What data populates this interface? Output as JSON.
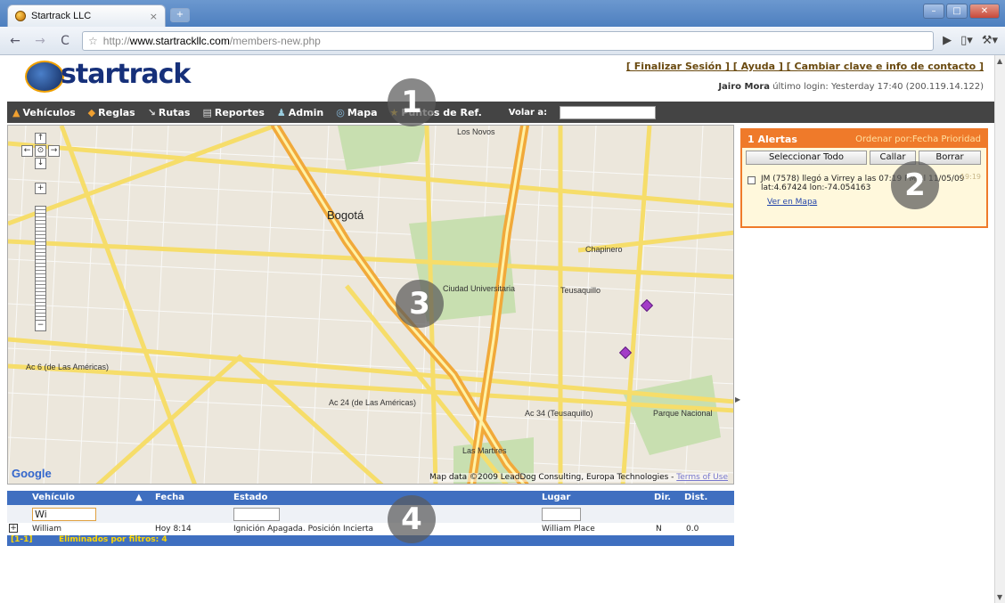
{
  "browser": {
    "tab_title": "Startrack LLC",
    "tab_close": "×",
    "url_proto": "http://",
    "url_host": "www.startrackllc.com",
    "url_path": "/members-new.php"
  },
  "header": {
    "logo_text": "startrack",
    "links": "[ Finalizar Sesión ] [ Ayuda ] [ Cambiar clave e info de contacto ]",
    "user_name": "Jairo Mora",
    "login_text": "último login: Yesterday 17:40 (200.119.14.122)"
  },
  "menu": {
    "items": [
      {
        "label": "Vehículos",
        "icon": "truck-icon"
      },
      {
        "label": "Reglas",
        "icon": "rules-icon"
      },
      {
        "label": "Rutas",
        "icon": "route-icon"
      },
      {
        "label": "Reportes",
        "icon": "report-icon"
      },
      {
        "label": "Admin",
        "icon": "admin-icon"
      },
      {
        "label": "Mapa",
        "icon": "globe-icon"
      },
      {
        "label": "Puntos de Ref.",
        "icon": "star-icon"
      }
    ],
    "volar_label": "Volar a:"
  },
  "map": {
    "city_label": "Bogotá",
    "labels": [
      "Ciudad Universitaria",
      "Teusaquillo",
      "Chapinero",
      "Parque Nacional",
      "Las Martires",
      "Los Novos",
      "Ac 6 (de Las Américas)",
      "Ac 24 (de Las Américas)",
      "Ac 34 (Teusaquillo)"
    ],
    "google": "Google",
    "attribution": "Map data ©2009 LeadDog Consulting, Europa Technologies -",
    "terms": "Terms of Use"
  },
  "alerts": {
    "title": "1 Alertas",
    "sort_label": "Ordenar por:Fecha Prioridad",
    "select_all": "Seleccionar Todo",
    "mute": "Callar",
    "delete": "Borrar",
    "item_text": "JM (7578) llegó a Virrey a las 07:19 PM el 11/05/09 lat:4.67424 lon:-74.054163",
    "item_time": "19:19",
    "map_link": "Ver en Mapa"
  },
  "grid": {
    "headers": {
      "vehiculo": "Vehículo",
      "fecha": "Fecha",
      "estado": "Estado",
      "lugar": "Lugar",
      "dir": "Dir.",
      "dist": "Dist."
    },
    "filter_value": "Wi",
    "row": {
      "vehiculo": "William",
      "fecha": "Hoy 8:14",
      "estado": "Ignición Apagada. Posición Incierta",
      "lugar": "William Place",
      "dir": "N",
      "dist": "0.0"
    },
    "footer_count": "[1-1]",
    "footer_text": "Eliminados por filtros: 4"
  },
  "overlays": [
    "1",
    "2",
    "3",
    "4"
  ]
}
